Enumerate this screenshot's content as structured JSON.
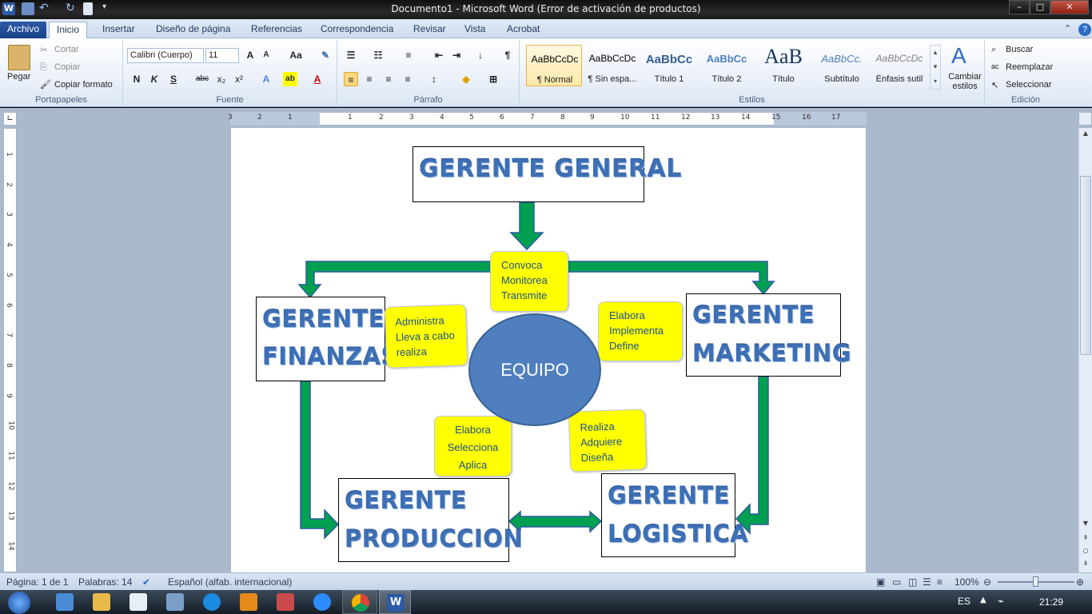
{
  "window": {
    "title": "Documento1  -  Microsoft Word (Error de activación de productos)",
    "min": "–",
    "max": "□",
    "close": "✕"
  },
  "tabs": [
    "Archivo",
    "Inicio",
    "Insertar",
    "Diseño de página",
    "Referencias",
    "Correspondencia",
    "Revisar",
    "Vista",
    "Acrobat"
  ],
  "ribbon": {
    "clipboard": {
      "paste": "Pegar",
      "cut": "Cortar",
      "copy": "Copiar",
      "format_painter": "Copiar formato",
      "label": "Portapapeles"
    },
    "font": {
      "name": "Calibri (Cuerpo)",
      "size": "11",
      "label": "Fuente",
      "bold": "N",
      "italic": "K",
      "underline": "S",
      "strike": "abc",
      "sub": "x₂",
      "sup": "x²"
    },
    "paragraph": {
      "label": "Párrafo"
    },
    "styles": {
      "label": "Estilos",
      "items": [
        {
          "preview": "AaBbCcDc",
          "name": "¶ Normal"
        },
        {
          "preview": "AaBbCcDc",
          "name": "¶ Sin espa..."
        },
        {
          "preview": "AaBbCc",
          "name": "Título 1"
        },
        {
          "preview": "AaBbCc",
          "name": "Título 2"
        },
        {
          "preview": "AaB",
          "name": "Título"
        },
        {
          "preview": "AaBbCc.",
          "name": "Subtítulo"
        },
        {
          "preview": "AaBbCcDc",
          "name": "Énfasis sutil"
        }
      ],
      "change": "Cambiar estilos"
    },
    "editing": {
      "label": "Edición",
      "find": "Buscar",
      "replace": "Reemplazar",
      "select": "Seleccionar"
    }
  },
  "ruler": {
    "h": [
      "3",
      "2",
      "1",
      "1",
      "2",
      "3",
      "4",
      "5",
      "6",
      "7",
      "8",
      "9",
      "10",
      "11",
      "12",
      "13",
      "14",
      "15",
      "16",
      "17"
    ],
    "v": [
      "1",
      "2",
      "3",
      "4",
      "5",
      "6",
      "7",
      "8",
      "9",
      "10",
      "11",
      "12",
      "13",
      "14"
    ]
  },
  "diagram": {
    "top": "GERENTE GENERAL",
    "finanzas": [
      "GERENTE",
      "FINANZAS"
    ],
    "marketing": [
      "GERENTE",
      "MARKETING"
    ],
    "produccion": [
      "GERENTE",
      "PRODUCCION"
    ],
    "logistica": [
      "GERENTE",
      "LOGISTICA"
    ],
    "center": "EQUIPO",
    "notes": {
      "top": [
        "Convoca",
        "Monitorea",
        "Transmite"
      ],
      "left": [
        "Administra",
        "Lleva a cabo",
        "realiza"
      ],
      "right": [
        "Elabora",
        "Implementa",
        "Define"
      ],
      "bottom_left": [
        "Elabora",
        "Selecciona",
        "Aplica"
      ],
      "bottom_right": [
        "Realiza",
        "Adquiere",
        "Diseña"
      ]
    },
    "arrow_color": "#00a050"
  },
  "status": {
    "page": "Página: 1 de 1",
    "words": "Palabras: 14",
    "language": "Español (alfab. internacional)",
    "zoom": "100%"
  },
  "taskbar": {
    "lang": "ES",
    "time": "21:29"
  }
}
